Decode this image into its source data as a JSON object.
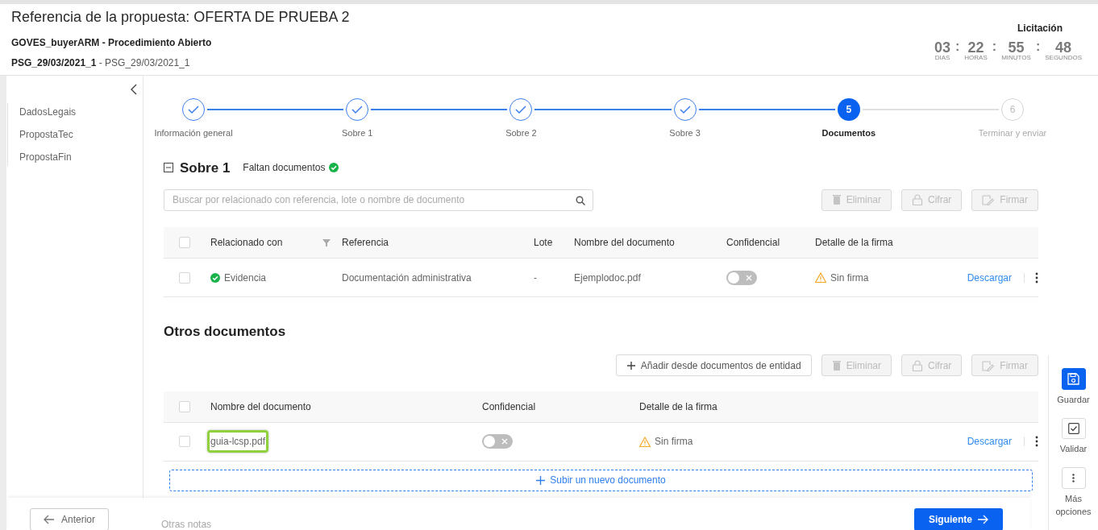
{
  "header": {
    "title": "Referencia de la propuesta: OFERTA DE PRUEBA 2",
    "organization": "GOVES_buyerARM - Procedimiento Abierto",
    "reference_code": "PSG_29/03/2021_1",
    "reference_separator": "-",
    "reference_name": "PSG_29/03/2021_1",
    "countdown": {
      "label": "Licitación",
      "units": [
        {
          "value": "03",
          "unit": "DIAS"
        },
        {
          "value": "22",
          "unit": "HORAS"
        },
        {
          "value": "55",
          "unit": "MINUTOS"
        },
        {
          "value": "48",
          "unit": "SEGUNDOS"
        }
      ],
      "separator": ":"
    }
  },
  "sidebar": {
    "items": [
      {
        "label": "DadosLegais"
      },
      {
        "label": "PropostaTec"
      },
      {
        "label": "PropostaFin"
      }
    ]
  },
  "steps": [
    {
      "label": "Información general",
      "completed": true,
      "current": false
    },
    {
      "label": "Sobre 1",
      "completed": true,
      "current": false
    },
    {
      "label": "Sobre 2",
      "completed": true,
      "current": false
    },
    {
      "label": "Sobre 3",
      "completed": true,
      "current": false
    },
    {
      "label": "Documentos",
      "completed": false,
      "current": true,
      "number": "5"
    },
    {
      "label": "Terminar y enviar",
      "completed": false,
      "current": false,
      "number": "6"
    }
  ],
  "sobre": {
    "title": "Sobre 1",
    "expanded": true,
    "status": "Faltan documentos",
    "status_ok": true,
    "search": {
      "placeholder": "Buscar por relacionado con referencia, lote o nombre de documento"
    },
    "buttons": [
      {
        "label": "Eliminar",
        "kind": "delete",
        "disabled": true
      },
      {
        "label": "Cifrar",
        "kind": "lock",
        "disabled": true
      },
      {
        "label": "Firmar",
        "kind": "sign",
        "disabled": true
      }
    ],
    "all_selected": false,
    "columns": [
      "Relacionado con",
      "Referencia",
      "Lote",
      "Nombre del documento",
      "Confidencial",
      "Detalle de la firma"
    ],
    "rows": [
      {
        "selected": false,
        "related": "Evidencia",
        "related_ok": true,
        "reference": "Documentación administrativa",
        "lot": "-",
        "document": "Ejemplodoc.pdf",
        "confidential": false,
        "signature": "Sin firma",
        "action": "Descargar"
      }
    ]
  },
  "others": {
    "title": "Otros documentos",
    "buttons": [
      {
        "label": "Añadir desde documentos de entidad",
        "kind": "add",
        "disabled": false
      },
      {
        "label": "Eliminar",
        "kind": "delete",
        "disabled": true
      },
      {
        "label": "Cifrar",
        "kind": "lock",
        "disabled": true
      },
      {
        "label": "Firmar",
        "kind": "sign",
        "disabled": true
      }
    ],
    "all_selected": false,
    "columns": [
      "Nombre del documento",
      "Confidencial",
      "Detalle de la firma"
    ],
    "rows": [
      {
        "selected": false,
        "document": "guia-lcsp.pdf",
        "highlighted": true,
        "confidential": false,
        "signature": "Sin firma",
        "action": "Descargar"
      }
    ],
    "upload": "Subir un nuevo documento"
  },
  "rail": [
    {
      "label": "Guardar",
      "kind": "save",
      "primary": true
    },
    {
      "label": "Validar",
      "kind": "check",
      "primary": false
    },
    {
      "label": "Más opciones",
      "kind": "more",
      "primary": false
    }
  ],
  "footer": {
    "previous": "Anterior",
    "behind_text": "Otras notas",
    "next": "Siguiente"
  }
}
